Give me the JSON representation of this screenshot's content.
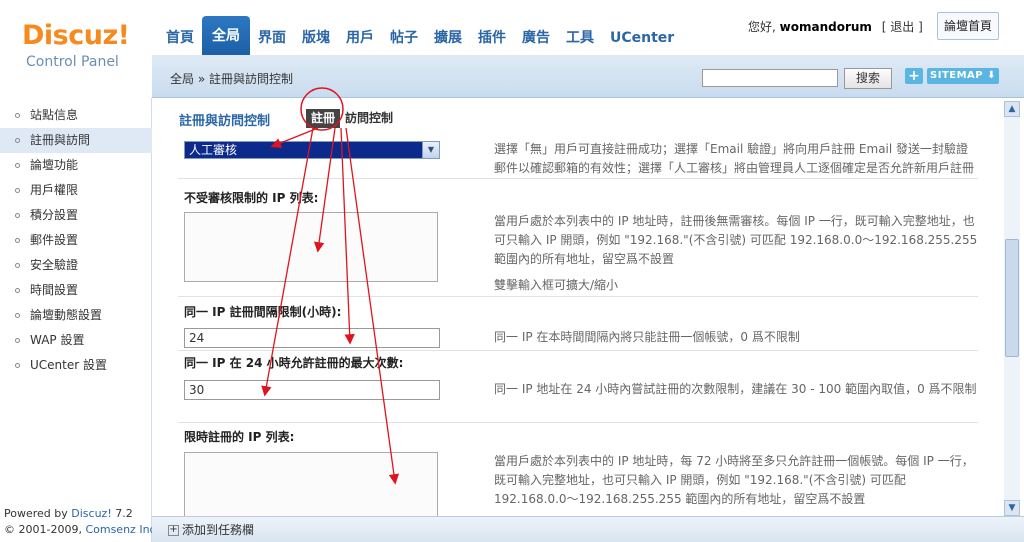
{
  "logo": {
    "brand": "Discuz!",
    "subtitle": "Control Panel"
  },
  "nav": {
    "tabs": [
      "首頁",
      "全局",
      "界面",
      "版塊",
      "用戶",
      "帖子",
      "擴展",
      "插件",
      "廣告",
      "工具",
      "UCenter"
    ],
    "active": "全局"
  },
  "user": {
    "greeting": "您好,",
    "name": "womandorum",
    "logout": "[ 退出 ]",
    "home_button": "論壇首頁"
  },
  "breadcrumb": "全局 » 註冊與訪問控制",
  "search": {
    "button": "搜索",
    "plus": "+",
    "sitemap": "SITEMAP ⬇"
  },
  "sidebar": {
    "items": [
      "站點信息",
      "註冊與訪問",
      "論壇功能",
      "用戶權限",
      "積分設置",
      "郵件設置",
      "安全驗證",
      "時間設置",
      "論壇動態設置",
      "WAP 設置",
      "UCenter 設置"
    ],
    "active_index": 1
  },
  "footer": {
    "powered": "Powered by ",
    "product": "Discuz!",
    "version": " 7.2",
    "copyright": "© 2001-2009, ",
    "company": "Comsenz Inc."
  },
  "main": {
    "title": "註冊與訪問控制",
    "subtabs": [
      "註冊",
      "訪問控制"
    ],
    "active_subtab": "註冊",
    "verify_select": "人工審核",
    "verify_desc": "選擇「無」用戶可直接註冊成功；選擇「Email 驗證」將向用戶註冊 Email 發送一封驗證郵件以確認郵箱的有效性；選擇「人工審核」將由管理員人工逐個確定是否允許新用戶註冊",
    "ip_list_label": "不受審核限制的 IP 列表:",
    "ip_list_desc": "當用戶處於本列表中的 IP 地址時，註冊後無需審核。每個 IP 一行，既可輸入完整地址，也可只輸入 IP 開頭，例如 \"192.168.\"(不含引號) 可匹配 192.168.0.0～192.168.255.255 範圍內的所有地址，留空爲不設置",
    "ip_list_resize": "雙擊輸入框可擴大/縮小",
    "interval_label": "同一 IP 註冊間隔限制(小時):",
    "interval_value": "24",
    "interval_desc": "同一 IP 在本時間間隔內將只能註冊一個帳號，0 爲不限制",
    "max_label": "同一 IP 在 24 小時允許註冊的最大次數:",
    "max_value": "30",
    "max_desc": "同一 IP 地址在 24 小時內嘗試註冊的次數限制，建議在 30 - 100 範圍內取值，0 爲不限制",
    "timed_label": "限時註冊的 IP 列表:",
    "timed_desc": "當用戶處於本列表中的 IP 地址時，每 72 小時將至多只允許註冊一個帳號。每個 IP 一行，既可輸入完整地址，也可只輸入 IP 開頭，例如 \"192.168.\"(不含引號) 可匹配 192.168.0.0～192.168.255.255 範圍內的所有地址，留空爲不設置"
  },
  "taskbar": {
    "add": "添加到任務欄"
  },
  "colors": {
    "accent": "#2b66a6",
    "logo": "#f68a1e",
    "annotation": "#e0141e"
  }
}
